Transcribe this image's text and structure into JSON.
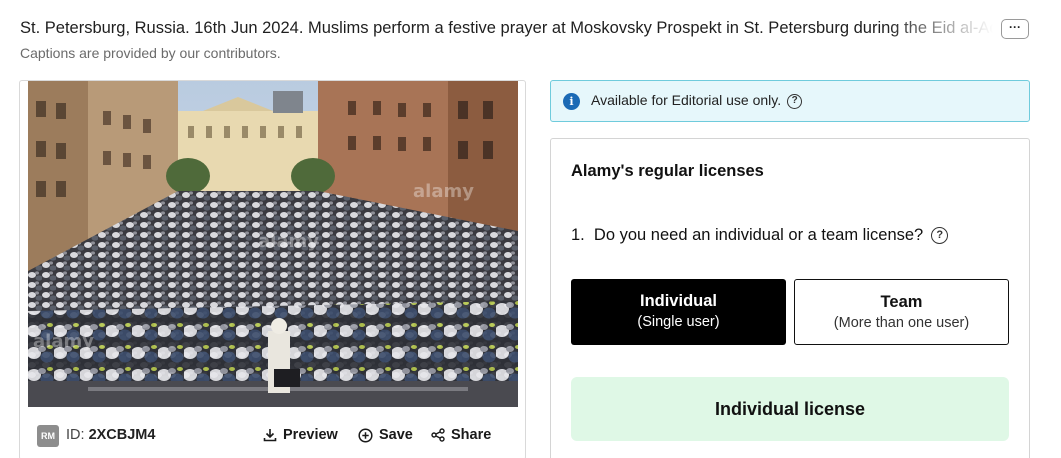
{
  "caption": {
    "text": "St. Petersburg, Russia. 16th Jun 2024. Muslims perform a festive prayer at Moskovsky Prospekt in St. Petersburg during the Eid al-Adha",
    "more_label": "···",
    "contributors_note": "Captions are provided by our contributors."
  },
  "image": {
    "watermark": "alamy",
    "license_badge": "RM",
    "id_label": "ID:",
    "id_value": "2XCBJM4",
    "actions": {
      "preview": "Preview",
      "save": "Save",
      "share": "Share"
    }
  },
  "editorial": {
    "text": "Available for Editorial use only.",
    "info_icon": "info-icon",
    "help_icon": "question-icon"
  },
  "licenses": {
    "title": "Alamy's regular licenses",
    "question": "1.  Do you need an individual or a team license?",
    "options": [
      {
        "title": "Individual",
        "subtitle": "(Single user)",
        "selected": true
      },
      {
        "title": "Team",
        "subtitle": "(More than one user)",
        "selected": false
      }
    ],
    "cta": "Individual license"
  },
  "colors": {
    "editorial_bg": "#e6f7fb",
    "editorial_border": "#6fcbdc",
    "info_icon": "#1b6ab5",
    "selected_option": "#000000",
    "cta_bg": "#dff8e6"
  }
}
